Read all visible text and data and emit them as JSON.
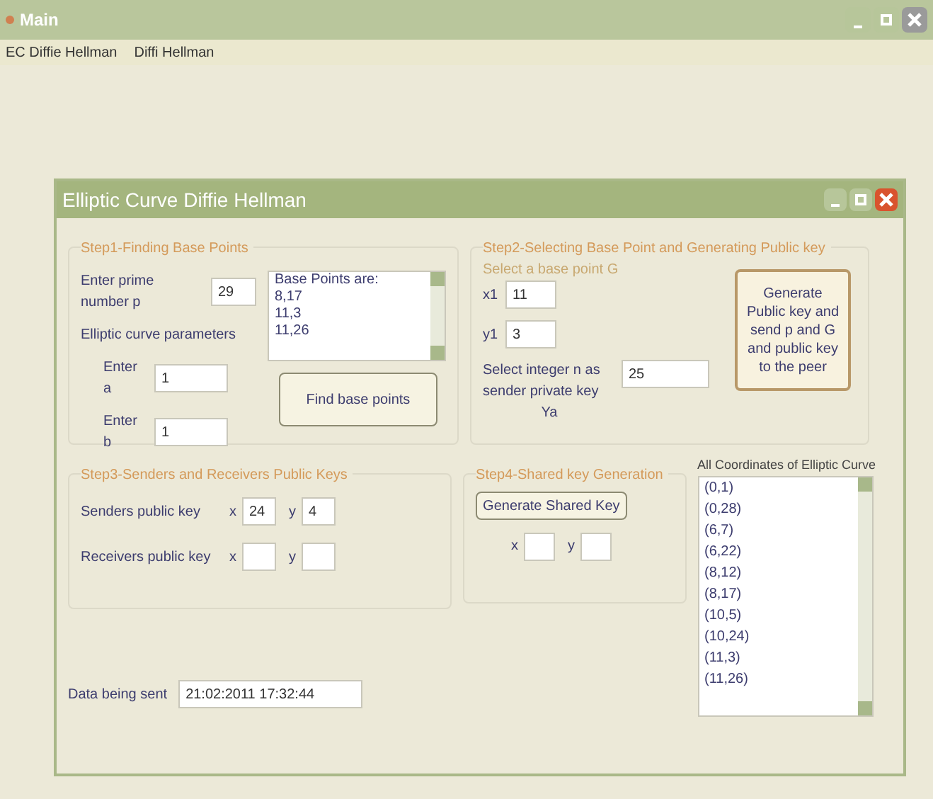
{
  "window": {
    "title": "Main"
  },
  "menu": [
    "EC Diffie Hellman",
    "Diffi Hellman"
  ],
  "child_window": {
    "title": "Elliptic Curve Diffie Hellman"
  },
  "step1": {
    "title": "Step1-Finding Base Points",
    "prime_label": "Enter prime number p",
    "prime_value": "29",
    "params_label": "Elliptic curve parameters",
    "a_label": "Enter a",
    "a_value": "1",
    "b_label": "Enter b",
    "b_value": "1",
    "base_points": [
      "Base Points are:",
      "8,17",
      "11,3",
      "11,26"
    ],
    "button": "Find base points"
  },
  "step2": {
    "title": "Step2-Selecting Base Point and Generating Public key",
    "subtitle": "Select a base point G",
    "x1_label": "x1",
    "x1_value": "11",
    "y1_label": "y1",
    "y1_value": "3",
    "private_label": "Select integer n as sender private key",
    "private_sub": "Ya",
    "private_value": "25",
    "button": "Generate Public key and send p and G and public key to the peer"
  },
  "step3": {
    "title": "Step3-Senders and Receivers Public Keys",
    "rows": [
      {
        "label": "Senders public key",
        "x_label": "x",
        "x_value": "24",
        "y_label": "y",
        "y_value": "4"
      },
      {
        "label": "Receivers public key",
        "x_label": "x",
        "y_label": "y"
      }
    ]
  },
  "step4": {
    "title": "Step4-Shared key Generation",
    "button": "Generate Shared Key",
    "x_label": "x",
    "y_label": "y"
  },
  "data": {
    "label": "Data being sent",
    "value": "21:02:2011 17:32:44"
  },
  "points": {
    "title": "All Coordinates of Elliptic Curve",
    "items": [
      "(0,1)",
      "(0,28)",
      "(6,7)",
      "(6,22)",
      "(8,12)",
      "(8,17)",
      "(10,5)",
      "(10,24)",
      "(11,3)",
      "(11,26)"
    ]
  }
}
